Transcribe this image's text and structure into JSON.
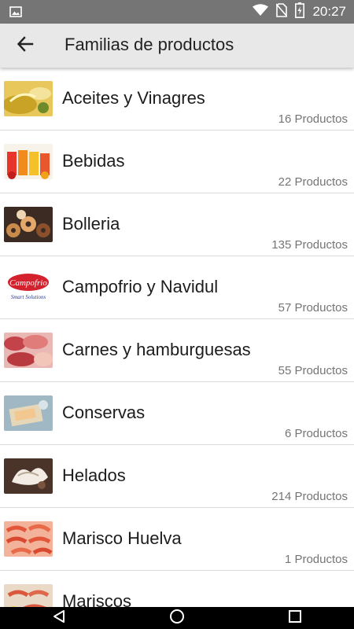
{
  "status_bar": {
    "time": "20:27",
    "icons": [
      "image-icon",
      "wifi-icon",
      "no-sim-icon",
      "battery-charging-icon"
    ]
  },
  "app_bar": {
    "title": "Familias de productos",
    "back_icon": "arrow-back-icon"
  },
  "families": [
    {
      "name": "Aceites y Vinagres",
      "count": "16 Productos"
    },
    {
      "name": "Bebidas",
      "count": "22 Productos"
    },
    {
      "name": "Bolleria",
      "count": "135 Productos"
    },
    {
      "name": "Campofrio y Navidul",
      "count": "57 Productos"
    },
    {
      "name": "Carnes y hamburguesas",
      "count": "55 Productos"
    },
    {
      "name": "Conservas",
      "count": "6 Productos"
    },
    {
      "name": "Helados",
      "count": "214 Productos"
    },
    {
      "name": "Marisco Huelva",
      "count": "1 Productos"
    },
    {
      "name": "Mariscos",
      "count": ""
    }
  ],
  "thumbnail_logo": {
    "brand": "Campofrio",
    "sub": "Smart Solutions"
  },
  "nav_bar": {
    "buttons": [
      "back-triangle-icon",
      "home-circle-icon",
      "recents-square-icon"
    ]
  },
  "colors": {
    "status_bar": "#757575",
    "app_bar": "#e8e8e8",
    "divider": "#d9d9d9",
    "count_text": "#757575"
  }
}
